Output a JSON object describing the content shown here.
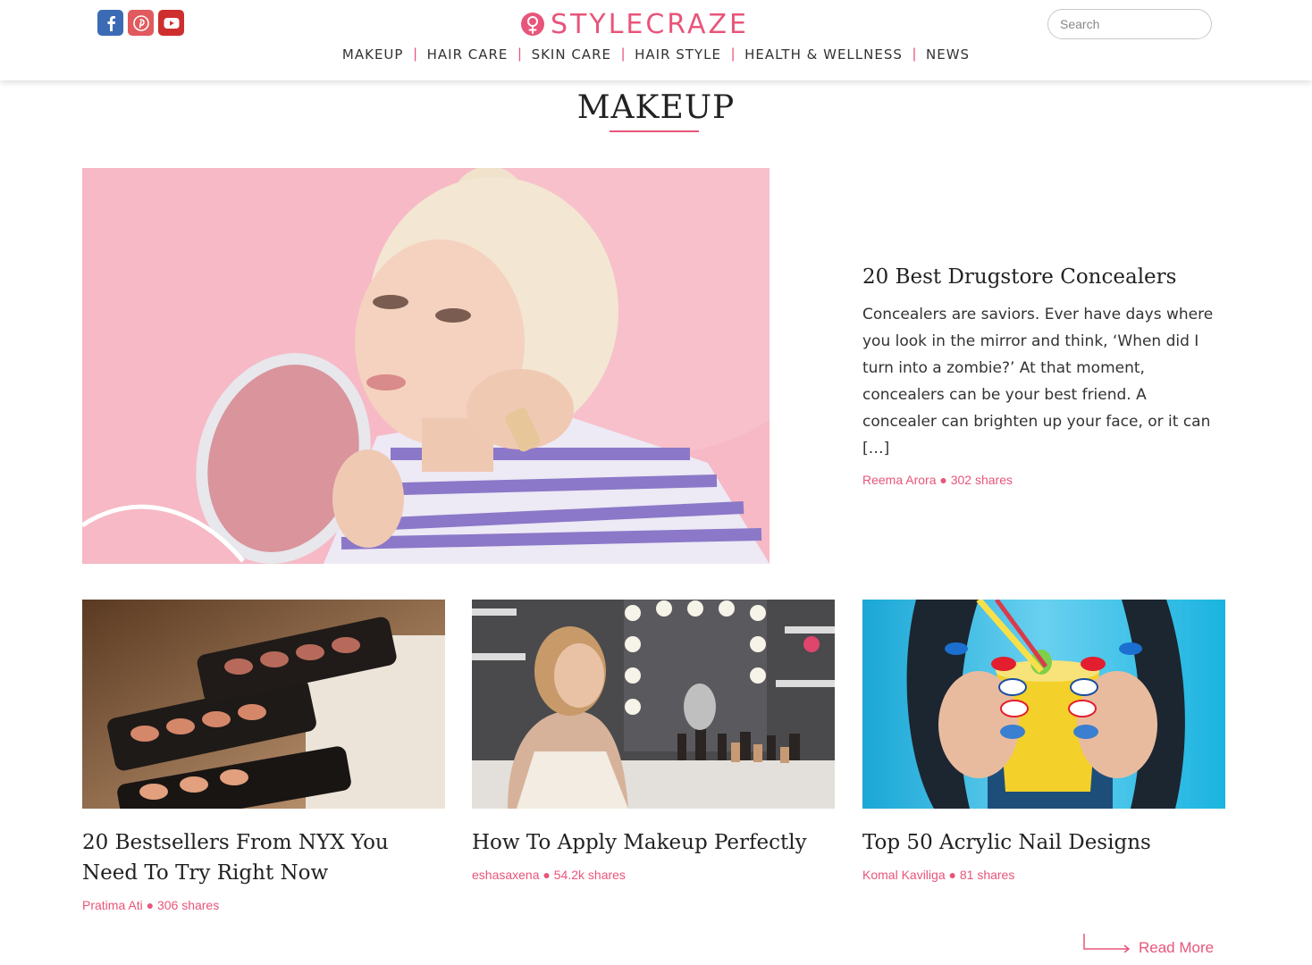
{
  "header": {
    "logo_text": "STYLECRAZE",
    "social_icons": [
      "facebook-icon",
      "pinterest-icon",
      "youtube-icon"
    ],
    "nav": [
      "MAKEUP",
      "HAIR CARE",
      "SKIN CARE",
      "HAIR STYLE",
      "HEALTH & WELLNESS",
      "NEWS"
    ],
    "search": {
      "placeholder": "Search",
      "value": ""
    }
  },
  "page": {
    "title": "MAKEUP"
  },
  "featured": {
    "title": "20 Best Drugstore Concealers",
    "excerpt": "Concealers are saviors. Ever have days where you look in the mirror and think, ‘When did I turn into a zombie?’ At that moment, concealers can be your best friend. A concealer can brighten up your face, or it can […]",
    "author": "Reema Arora",
    "shares": "302 shares"
  },
  "cards": [
    {
      "title": "20 Bestsellers From NYX You Need To Try Right Now",
      "author": "Pratima Ati",
      "shares": "306 shares"
    },
    {
      "title": "How To Apply Makeup Perfectly",
      "author": "eshasaxena",
      "shares": "54.2k shares"
    },
    {
      "title": "Top 50 Acrylic Nail Designs",
      "author": "Komal Kaviliga",
      "shares": "81 shares"
    }
  ],
  "read_more": "Read More",
  "colors": {
    "accent": "#e8557a",
    "facebook": "#3b6bb5",
    "pinterest": "#e05a5e",
    "youtube": "#cf2e2e"
  }
}
